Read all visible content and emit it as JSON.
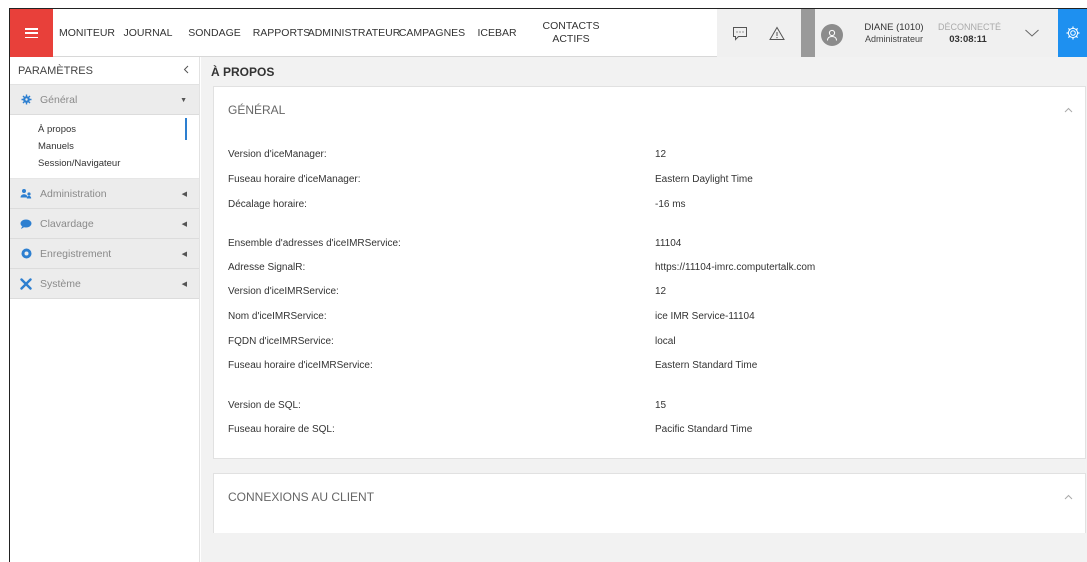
{
  "topbar": {
    "nav": [
      "MONITEUR",
      "JOURNAL",
      "SONDAGE",
      "RAPPORTS",
      "ADMINISTRATEUR",
      "CAMPAGNES",
      "ICEBAR"
    ],
    "contacts_line1": "CONTACTS",
    "contacts_line2": "ACTIFS",
    "user_name": "DIANE (1010)",
    "user_role": "Administrateur",
    "status_label": "DÉCONNECTÉ",
    "status_time": "03:08:11"
  },
  "sidebar": {
    "title": "PARAMÈTRES",
    "sections": [
      {
        "label": "Général",
        "icon": "gear-icon"
      },
      {
        "label": "Administration",
        "icon": "users-icon"
      },
      {
        "label": "Clavardage",
        "icon": "chat-icon"
      },
      {
        "label": "Enregistrement",
        "icon": "record-icon"
      },
      {
        "label": "Système",
        "icon": "tools-icon"
      }
    ],
    "general_items": [
      "À propos",
      "Manuels",
      "Session/Navigateur"
    ]
  },
  "main": {
    "page_title": "À PROPOS",
    "general_card_title": "GÉNÉRAL",
    "connexions_card_title": "CONNEXIONS AU CLIENT",
    "info": [
      {
        "key": "Version d'iceManager:",
        "value": "12"
      },
      {
        "key": "Fuseau horaire d'iceManager:",
        "value": "Eastern Daylight Time"
      },
      {
        "key": "Décalage horaire:",
        "value": "-16 ms"
      },
      {
        "key": "Ensemble d'adresses d'iceIMRService:",
        "value": "11104"
      },
      {
        "key": "Adresse SignalR:",
        "value": "https://11104-imrc.computertalk.com"
      },
      {
        "key": "Version d'iceIMRService:",
        "value": "12"
      },
      {
        "key": "Nom d'iceIMRService:",
        "value": "ice IMR Service-11104"
      },
      {
        "key": "FQDN d'iceIMRService:",
        "value": "local"
      },
      {
        "key": "Fuseau horaire d'iceIMRService:",
        "value": "Eastern Standard Time"
      },
      {
        "key": "Version de SQL:",
        "value": "15"
      },
      {
        "key": "Fuseau horaire de SQL:",
        "value": "Pacific Standard Time"
      }
    ]
  },
  "colors": {
    "menu_button": "#e8403a",
    "settings_button": "#1e90f0",
    "sidebar_active_marker": "#2d7fd0"
  }
}
